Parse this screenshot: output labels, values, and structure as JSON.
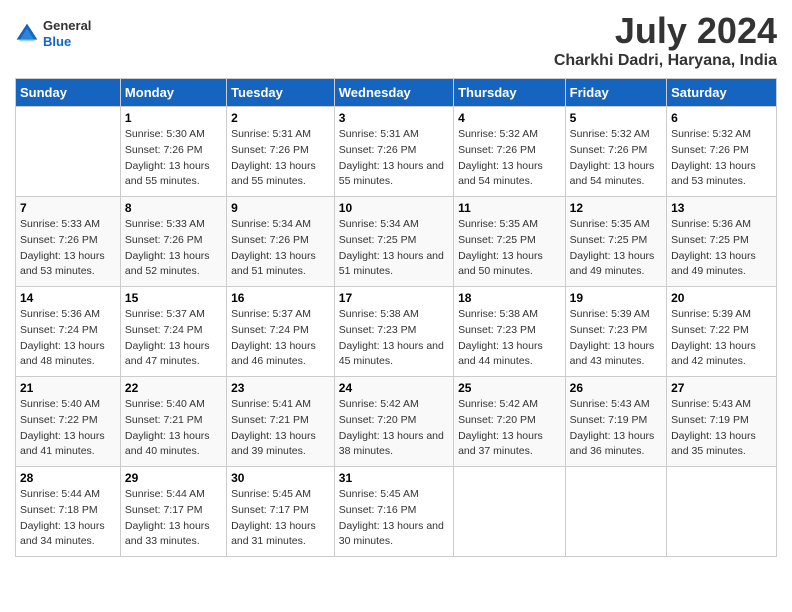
{
  "header": {
    "logo": {
      "general": "General",
      "blue": "Blue"
    },
    "title": "July 2024",
    "subtitle": "Charkhi Dadri, Haryana, India"
  },
  "columns": [
    "Sunday",
    "Monday",
    "Tuesday",
    "Wednesday",
    "Thursday",
    "Friday",
    "Saturday"
  ],
  "weeks": [
    [
      {
        "day": "",
        "sunrise": "",
        "sunset": "",
        "daylight": ""
      },
      {
        "day": "1",
        "sunrise": "Sunrise: 5:30 AM",
        "sunset": "Sunset: 7:26 PM",
        "daylight": "Daylight: 13 hours and 55 minutes."
      },
      {
        "day": "2",
        "sunrise": "Sunrise: 5:31 AM",
        "sunset": "Sunset: 7:26 PM",
        "daylight": "Daylight: 13 hours and 55 minutes."
      },
      {
        "day": "3",
        "sunrise": "Sunrise: 5:31 AM",
        "sunset": "Sunset: 7:26 PM",
        "daylight": "Daylight: 13 hours and 55 minutes."
      },
      {
        "day": "4",
        "sunrise": "Sunrise: 5:32 AM",
        "sunset": "Sunset: 7:26 PM",
        "daylight": "Daylight: 13 hours and 54 minutes."
      },
      {
        "day": "5",
        "sunrise": "Sunrise: 5:32 AM",
        "sunset": "Sunset: 7:26 PM",
        "daylight": "Daylight: 13 hours and 54 minutes."
      },
      {
        "day": "6",
        "sunrise": "Sunrise: 5:32 AM",
        "sunset": "Sunset: 7:26 PM",
        "daylight": "Daylight: 13 hours and 53 minutes."
      }
    ],
    [
      {
        "day": "7",
        "sunrise": "Sunrise: 5:33 AM",
        "sunset": "Sunset: 7:26 PM",
        "daylight": "Daylight: 13 hours and 53 minutes."
      },
      {
        "day": "8",
        "sunrise": "Sunrise: 5:33 AM",
        "sunset": "Sunset: 7:26 PM",
        "daylight": "Daylight: 13 hours and 52 minutes."
      },
      {
        "day": "9",
        "sunrise": "Sunrise: 5:34 AM",
        "sunset": "Sunset: 7:26 PM",
        "daylight": "Daylight: 13 hours and 51 minutes."
      },
      {
        "day": "10",
        "sunrise": "Sunrise: 5:34 AM",
        "sunset": "Sunset: 7:25 PM",
        "daylight": "Daylight: 13 hours and 51 minutes."
      },
      {
        "day": "11",
        "sunrise": "Sunrise: 5:35 AM",
        "sunset": "Sunset: 7:25 PM",
        "daylight": "Daylight: 13 hours and 50 minutes."
      },
      {
        "day": "12",
        "sunrise": "Sunrise: 5:35 AM",
        "sunset": "Sunset: 7:25 PM",
        "daylight": "Daylight: 13 hours and 49 minutes."
      },
      {
        "day": "13",
        "sunrise": "Sunrise: 5:36 AM",
        "sunset": "Sunset: 7:25 PM",
        "daylight": "Daylight: 13 hours and 49 minutes."
      }
    ],
    [
      {
        "day": "14",
        "sunrise": "Sunrise: 5:36 AM",
        "sunset": "Sunset: 7:24 PM",
        "daylight": "Daylight: 13 hours and 48 minutes."
      },
      {
        "day": "15",
        "sunrise": "Sunrise: 5:37 AM",
        "sunset": "Sunset: 7:24 PM",
        "daylight": "Daylight: 13 hours and 47 minutes."
      },
      {
        "day": "16",
        "sunrise": "Sunrise: 5:37 AM",
        "sunset": "Sunset: 7:24 PM",
        "daylight": "Daylight: 13 hours and 46 minutes."
      },
      {
        "day": "17",
        "sunrise": "Sunrise: 5:38 AM",
        "sunset": "Sunset: 7:23 PM",
        "daylight": "Daylight: 13 hours and 45 minutes."
      },
      {
        "day": "18",
        "sunrise": "Sunrise: 5:38 AM",
        "sunset": "Sunset: 7:23 PM",
        "daylight": "Daylight: 13 hours and 44 minutes."
      },
      {
        "day": "19",
        "sunrise": "Sunrise: 5:39 AM",
        "sunset": "Sunset: 7:23 PM",
        "daylight": "Daylight: 13 hours and 43 minutes."
      },
      {
        "day": "20",
        "sunrise": "Sunrise: 5:39 AM",
        "sunset": "Sunset: 7:22 PM",
        "daylight": "Daylight: 13 hours and 42 minutes."
      }
    ],
    [
      {
        "day": "21",
        "sunrise": "Sunrise: 5:40 AM",
        "sunset": "Sunset: 7:22 PM",
        "daylight": "Daylight: 13 hours and 41 minutes."
      },
      {
        "day": "22",
        "sunrise": "Sunrise: 5:40 AM",
        "sunset": "Sunset: 7:21 PM",
        "daylight": "Daylight: 13 hours and 40 minutes."
      },
      {
        "day": "23",
        "sunrise": "Sunrise: 5:41 AM",
        "sunset": "Sunset: 7:21 PM",
        "daylight": "Daylight: 13 hours and 39 minutes."
      },
      {
        "day": "24",
        "sunrise": "Sunrise: 5:42 AM",
        "sunset": "Sunset: 7:20 PM",
        "daylight": "Daylight: 13 hours and 38 minutes."
      },
      {
        "day": "25",
        "sunrise": "Sunrise: 5:42 AM",
        "sunset": "Sunset: 7:20 PM",
        "daylight": "Daylight: 13 hours and 37 minutes."
      },
      {
        "day": "26",
        "sunrise": "Sunrise: 5:43 AM",
        "sunset": "Sunset: 7:19 PM",
        "daylight": "Daylight: 13 hours and 36 minutes."
      },
      {
        "day": "27",
        "sunrise": "Sunrise: 5:43 AM",
        "sunset": "Sunset: 7:19 PM",
        "daylight": "Daylight: 13 hours and 35 minutes."
      }
    ],
    [
      {
        "day": "28",
        "sunrise": "Sunrise: 5:44 AM",
        "sunset": "Sunset: 7:18 PM",
        "daylight": "Daylight: 13 hours and 34 minutes."
      },
      {
        "day": "29",
        "sunrise": "Sunrise: 5:44 AM",
        "sunset": "Sunset: 7:17 PM",
        "daylight": "Daylight: 13 hours and 33 minutes."
      },
      {
        "day": "30",
        "sunrise": "Sunrise: 5:45 AM",
        "sunset": "Sunset: 7:17 PM",
        "daylight": "Daylight: 13 hours and 31 minutes."
      },
      {
        "day": "31",
        "sunrise": "Sunrise: 5:45 AM",
        "sunset": "Sunset: 7:16 PM",
        "daylight": "Daylight: 13 hours and 30 minutes."
      },
      {
        "day": "",
        "sunrise": "",
        "sunset": "",
        "daylight": ""
      },
      {
        "day": "",
        "sunrise": "",
        "sunset": "",
        "daylight": ""
      },
      {
        "day": "",
        "sunrise": "",
        "sunset": "",
        "daylight": ""
      }
    ]
  ]
}
